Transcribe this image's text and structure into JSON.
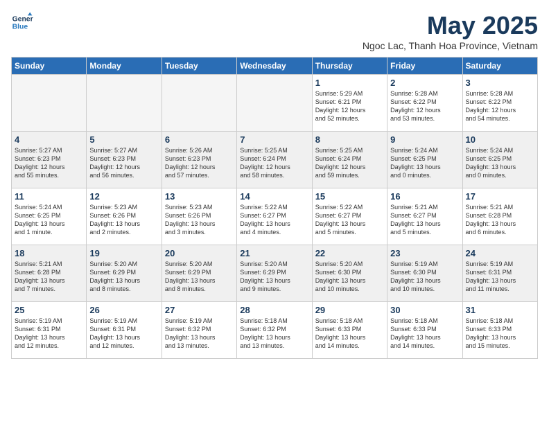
{
  "logo": {
    "line1": "General",
    "line2": "Blue"
  },
  "title": "May 2025",
  "subtitle": "Ngoc Lac, Thanh Hoa Province, Vietnam",
  "days_of_week": [
    "Sunday",
    "Monday",
    "Tuesday",
    "Wednesday",
    "Thursday",
    "Friday",
    "Saturday"
  ],
  "weeks": [
    [
      {
        "day": "",
        "info": ""
      },
      {
        "day": "",
        "info": ""
      },
      {
        "day": "",
        "info": ""
      },
      {
        "day": "",
        "info": ""
      },
      {
        "day": "1",
        "info": "Sunrise: 5:29 AM\nSunset: 6:21 PM\nDaylight: 12 hours\nand 52 minutes."
      },
      {
        "day": "2",
        "info": "Sunrise: 5:28 AM\nSunset: 6:22 PM\nDaylight: 12 hours\nand 53 minutes."
      },
      {
        "day": "3",
        "info": "Sunrise: 5:28 AM\nSunset: 6:22 PM\nDaylight: 12 hours\nand 54 minutes."
      }
    ],
    [
      {
        "day": "4",
        "info": "Sunrise: 5:27 AM\nSunset: 6:23 PM\nDaylight: 12 hours\nand 55 minutes."
      },
      {
        "day": "5",
        "info": "Sunrise: 5:27 AM\nSunset: 6:23 PM\nDaylight: 12 hours\nand 56 minutes."
      },
      {
        "day": "6",
        "info": "Sunrise: 5:26 AM\nSunset: 6:23 PM\nDaylight: 12 hours\nand 57 minutes."
      },
      {
        "day": "7",
        "info": "Sunrise: 5:25 AM\nSunset: 6:24 PM\nDaylight: 12 hours\nand 58 minutes."
      },
      {
        "day": "8",
        "info": "Sunrise: 5:25 AM\nSunset: 6:24 PM\nDaylight: 12 hours\nand 59 minutes."
      },
      {
        "day": "9",
        "info": "Sunrise: 5:24 AM\nSunset: 6:25 PM\nDaylight: 13 hours\nand 0 minutes."
      },
      {
        "day": "10",
        "info": "Sunrise: 5:24 AM\nSunset: 6:25 PM\nDaylight: 13 hours\nand 0 minutes."
      }
    ],
    [
      {
        "day": "11",
        "info": "Sunrise: 5:24 AM\nSunset: 6:25 PM\nDaylight: 13 hours\nand 1 minute."
      },
      {
        "day": "12",
        "info": "Sunrise: 5:23 AM\nSunset: 6:26 PM\nDaylight: 13 hours\nand 2 minutes."
      },
      {
        "day": "13",
        "info": "Sunrise: 5:23 AM\nSunset: 6:26 PM\nDaylight: 13 hours\nand 3 minutes."
      },
      {
        "day": "14",
        "info": "Sunrise: 5:22 AM\nSunset: 6:27 PM\nDaylight: 13 hours\nand 4 minutes."
      },
      {
        "day": "15",
        "info": "Sunrise: 5:22 AM\nSunset: 6:27 PM\nDaylight: 13 hours\nand 5 minutes."
      },
      {
        "day": "16",
        "info": "Sunrise: 5:21 AM\nSunset: 6:27 PM\nDaylight: 13 hours\nand 5 minutes."
      },
      {
        "day": "17",
        "info": "Sunrise: 5:21 AM\nSunset: 6:28 PM\nDaylight: 13 hours\nand 6 minutes."
      }
    ],
    [
      {
        "day": "18",
        "info": "Sunrise: 5:21 AM\nSunset: 6:28 PM\nDaylight: 13 hours\nand 7 minutes."
      },
      {
        "day": "19",
        "info": "Sunrise: 5:20 AM\nSunset: 6:29 PM\nDaylight: 13 hours\nand 8 minutes."
      },
      {
        "day": "20",
        "info": "Sunrise: 5:20 AM\nSunset: 6:29 PM\nDaylight: 13 hours\nand 8 minutes."
      },
      {
        "day": "21",
        "info": "Sunrise: 5:20 AM\nSunset: 6:29 PM\nDaylight: 13 hours\nand 9 minutes."
      },
      {
        "day": "22",
        "info": "Sunrise: 5:20 AM\nSunset: 6:30 PM\nDaylight: 13 hours\nand 10 minutes."
      },
      {
        "day": "23",
        "info": "Sunrise: 5:19 AM\nSunset: 6:30 PM\nDaylight: 13 hours\nand 10 minutes."
      },
      {
        "day": "24",
        "info": "Sunrise: 5:19 AM\nSunset: 6:31 PM\nDaylight: 13 hours\nand 11 minutes."
      }
    ],
    [
      {
        "day": "25",
        "info": "Sunrise: 5:19 AM\nSunset: 6:31 PM\nDaylight: 13 hours\nand 12 minutes."
      },
      {
        "day": "26",
        "info": "Sunrise: 5:19 AM\nSunset: 6:31 PM\nDaylight: 13 hours\nand 12 minutes."
      },
      {
        "day": "27",
        "info": "Sunrise: 5:19 AM\nSunset: 6:32 PM\nDaylight: 13 hours\nand 13 minutes."
      },
      {
        "day": "28",
        "info": "Sunrise: 5:18 AM\nSunset: 6:32 PM\nDaylight: 13 hours\nand 13 minutes."
      },
      {
        "day": "29",
        "info": "Sunrise: 5:18 AM\nSunset: 6:33 PM\nDaylight: 13 hours\nand 14 minutes."
      },
      {
        "day": "30",
        "info": "Sunrise: 5:18 AM\nSunset: 6:33 PM\nDaylight: 13 hours\nand 14 minutes."
      },
      {
        "day": "31",
        "info": "Sunrise: 5:18 AM\nSunset: 6:33 PM\nDaylight: 13 hours\nand 15 minutes."
      }
    ]
  ]
}
